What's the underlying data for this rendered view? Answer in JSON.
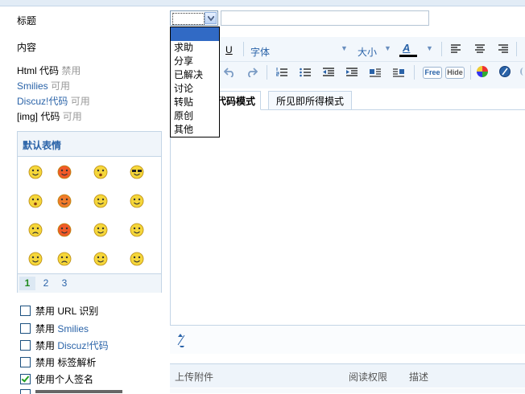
{
  "form": {
    "title_label": "标题",
    "content_label": "内容",
    "category_options": [
      "",
      "求助",
      "分享",
      "已解决",
      "讨论",
      "转贴",
      "原创",
      "其他"
    ],
    "title_value": ""
  },
  "status": {
    "html": {
      "name": "Html 代码",
      "state": "禁用"
    },
    "smilies": {
      "name": "Smilies",
      "state": "可用"
    },
    "discuz": {
      "name": "Discuz!代码",
      "state": "可用"
    },
    "img": {
      "name": "[img] 代码",
      "state": "可用"
    }
  },
  "smilies_panel": {
    "title": "默认表情",
    "pages": [
      "1",
      "2",
      "3"
    ],
    "current_page": "1"
  },
  "options": [
    {
      "prefix": "禁用 ",
      "name": "URL 识别",
      "name_link": false,
      "checked": false
    },
    {
      "prefix": "禁用 ",
      "name": "Smilies",
      "name_link": true,
      "checked": false
    },
    {
      "prefix": "禁用 ",
      "name": "Discuz!代码",
      "name_link": true,
      "checked": false
    },
    {
      "prefix": "禁用 ",
      "name": "标签解析",
      "name_link": false,
      "checked": false
    },
    {
      "prefix": "",
      "name": "使用个人签名",
      "name_link": false,
      "checked": true
    }
  ],
  "toolbar": {
    "underline": "U",
    "font": "字体",
    "size": "大小",
    "color_letter": "A",
    "free": "Free",
    "hide": "Hide"
  },
  "editor_tabs": {
    "code_mode": "代码模式",
    "wysiwyg_mode": "所见即所得模式"
  },
  "attachments": {
    "col_upload": "上传附件",
    "col_permission": "阅读权限",
    "col_desc": "描述"
  },
  "colors": {
    "accent_blue": "#2a63a8",
    "selected_option": "#316ac5",
    "border": "#c4d5e6",
    "check_green": "#21a121"
  }
}
